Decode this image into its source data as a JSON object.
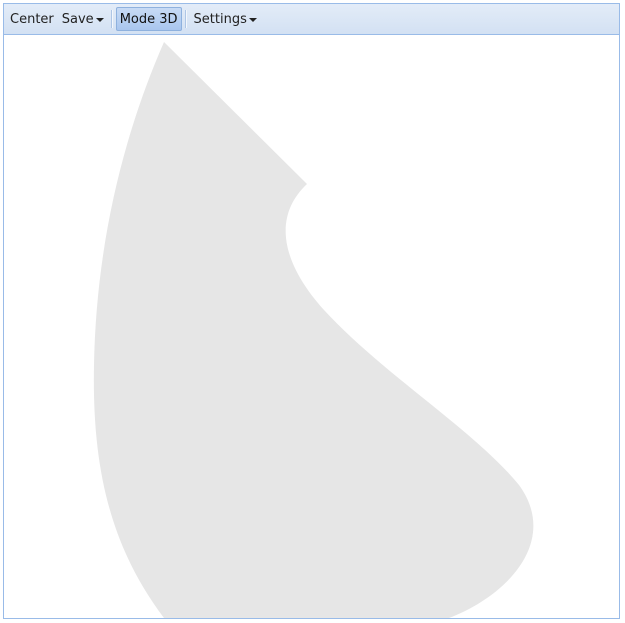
{
  "toolbar": {
    "center_label": "Center",
    "save_label": "Save",
    "mode_label": "Mode 3D",
    "settings_label": "Settings"
  },
  "viewport": {
    "shape_color": "#e6e6e6",
    "background_color": "#ffffff"
  }
}
